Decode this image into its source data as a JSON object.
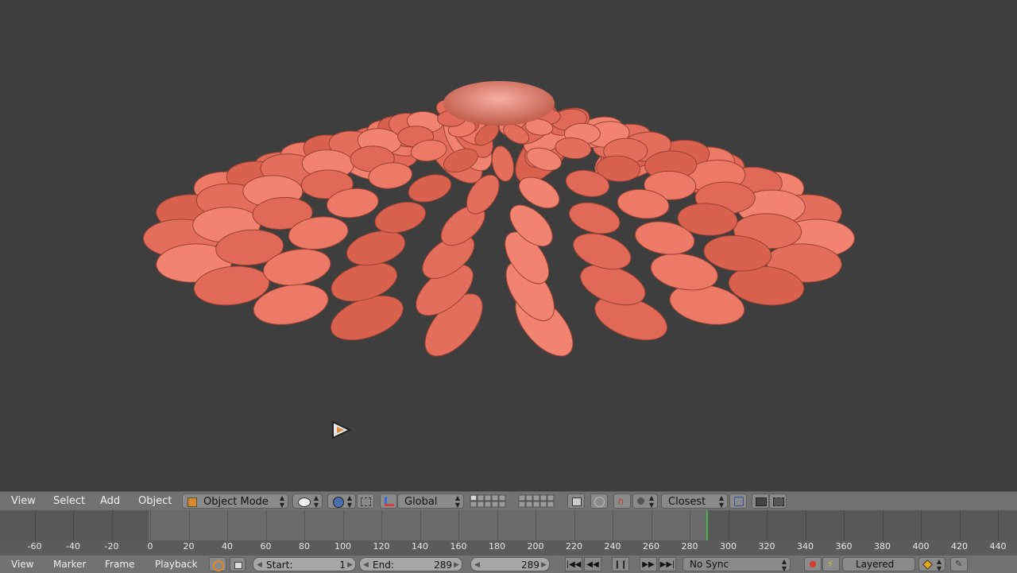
{
  "header3d": {
    "menus": [
      "View",
      "Select",
      "Add",
      "Object"
    ],
    "mode_label": "Object Mode",
    "orientation_label": "Global",
    "snap_label": "Closest"
  },
  "timeline": {
    "ruler_ticks": [
      "-60",
      "-40",
      "-20",
      "0",
      "20",
      "40",
      "60",
      "80",
      "100",
      "120",
      "140",
      "160",
      "180",
      "200",
      "220",
      "240",
      "260",
      "280",
      "300",
      "320",
      "340",
      "360",
      "380",
      "400",
      "420",
      "440"
    ],
    "current_frame": 289
  },
  "timeline_header": {
    "menus": [
      "View",
      "Marker",
      "Frame",
      "Playback"
    ],
    "start_label": "Start:",
    "start_value": "1",
    "end_label": "End:",
    "end_value": "289",
    "current_value": "289",
    "sync_label": "No Sync",
    "keying_label": "Layered"
  },
  "colors": {
    "accent_record": "#d43c2c",
    "frame_marker": "#49b14b",
    "petal": "#e8705e"
  },
  "icons": [
    "play-cursor-icon",
    "cube-icon",
    "viewport-shading-icon",
    "pivot-icon",
    "manipulator-icon",
    "layer-icon",
    "snap-magnet-icon",
    "proportional-edit-icon",
    "render-icon",
    "record-icon",
    "keying-icon",
    "lock-icon",
    "jump-start-icon",
    "prev-key-icon",
    "pause-icon",
    "next-key-icon",
    "jump-end-icon"
  ]
}
